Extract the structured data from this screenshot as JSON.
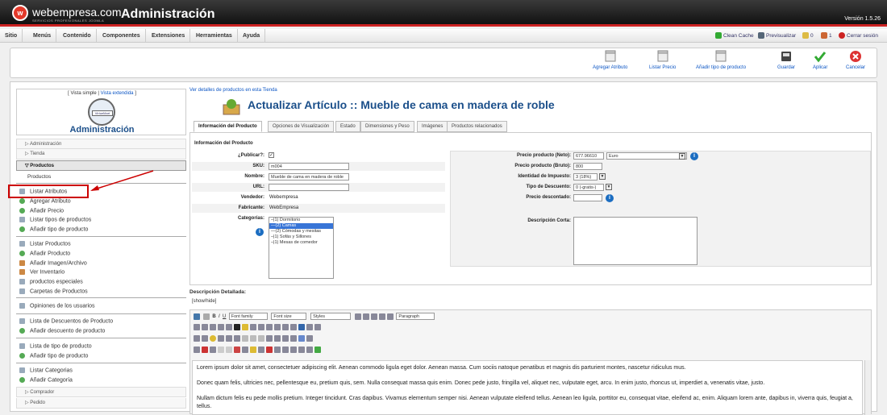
{
  "header": {
    "logo_text": "webempresa.com",
    "logo_sub": "SERVICIOS PROFESIONALES JOOMLA",
    "title": "Administración",
    "version": "Versión 1.5.26"
  },
  "menu": {
    "items": [
      "Sitio",
      "Menús",
      "Contenido",
      "Componentes",
      "Extensiones",
      "Herramientas",
      "Ayuda"
    ],
    "clean_cache": "Clean Cache",
    "preview": "Previsualizar",
    "messages": "0",
    "users": "1",
    "logout": "Cerrar sesión"
  },
  "toolbar": {
    "add_attribute": "Agregar Atributo",
    "price_list": "Listar Precio",
    "add_product_type": "Añadir tipo de producto",
    "save": "Guardar",
    "apply": "Aplicar",
    "cancel": "Cancelar"
  },
  "sidebar": {
    "simple_view": "[ Vista simple |",
    "extended_view": "Vista extendida",
    "close_bracket": "]",
    "vm_label": "VirtueMart",
    "title": "Administración",
    "sections": [
      "Administración",
      "Tienda",
      "Productos"
    ],
    "products_sub": "Productos",
    "links": [
      "Listar Atributos",
      "Agregar Atributo",
      "Añadir Precio",
      "Listar tipos de productos",
      "Añadir tipo de producto",
      "Listar Productos",
      "Añadir Producto",
      "Añadir Imagen/Archivo",
      "Ver Inventario",
      "productos especiales",
      "Carpetas de Productos",
      "Opiniones de los usuarios",
      "Lista de Descuentos de Producto",
      "Añadir descuento de producto",
      "Lista de tipo de producto",
      "Añadir tipo de producto",
      "Listar Categorias",
      "Añadir Categoría"
    ],
    "bottom_sections": [
      "Comprador",
      "Pedido"
    ]
  },
  "content": {
    "breadcrumb": "Ver detalles de productos en esta Tienda",
    "title": "Actualizar Artículo :: Mueble de cama en madera de roble",
    "tabs": [
      "Información del Producto",
      "Opciones de Visualización",
      "Estado",
      "Dimensiones y Peso",
      "Imágenes",
      "Productos relacionados"
    ],
    "section_title": "Información del Producto",
    "fields": {
      "publish_label": "¿Publicar?:",
      "publish_checked": "✓",
      "sku_label": "SKU:",
      "sku_value": "m004",
      "name_label": "Nombre:",
      "name_value": "Mueble de cama en madera de roble",
      "url_label": "URL:",
      "url_value": "",
      "vendor_label": "Vendedor:",
      "vendor_value": "Webempresa",
      "manufacturer_label": "Fabricante:",
      "manufacturer_value": "WebEmpresa",
      "categories_label": "Categorías:",
      "categories": [
        "–|1) Dormitorio",
        "—(2) Camas",
        "—(2) Cómodas y mesitas",
        "–|1) Sofás y Sillones",
        "–|1) Mesas de comedor"
      ],
      "selected_category_index": 1
    },
    "pricing": {
      "net_label": "Precio producto (Neto):",
      "net_value": "677.96610",
      "currency": "Euro",
      "gross_label": "Precio producto (Bruto):",
      "gross_value": "800",
      "tax_label": "Identidad de Impuesto:",
      "tax_value": "3 (18%)",
      "discount_type_label": "Tipo de Descuento:",
      "discount_type_value": "0 (-gratis-)",
      "discounted_label": "Precio descontado:",
      "discounted_value": "",
      "short_desc_label": "Descripción Corta:"
    },
    "detailed_desc_label": "Descripción Detallada:",
    "show_hide": "[show/hide]",
    "editor": {
      "font_family": "Font family",
      "font_size": "Font size",
      "styles": "Styles",
      "paragraph": "Paragraph",
      "paragraphs": [
        "Lorem ipsum dolor sit amet, consectetuer adipiscing elit. Aenean commodo ligula eget dolor. Aenean massa. Cum sociis natoque penatibus et magnis dis parturient montes, nascetur ridiculus mus.",
        "Donec quam felis, ultricies nec, pellentesque eu, pretium quis, sem. Nulla consequat massa quis enim. Donec pede justo, fringilla vel, aliquet nec, vulputate eget, arcu. In enim justo, rhoncus ut, imperdiet a, venenatis vitae, justo.",
        "Nullam dictum felis eu pede mollis pretium. Integer tincidunt. Cras dapibus. Vivamus elementum semper nisi. Aenean vulputate eleifend tellus. Aenean leo ligula, porttitor eu, consequat vitae, eleifend ac, enim. Aliquam lorem ante, dapibus in, viverra quis, feugiat a, tellus."
      ]
    }
  }
}
